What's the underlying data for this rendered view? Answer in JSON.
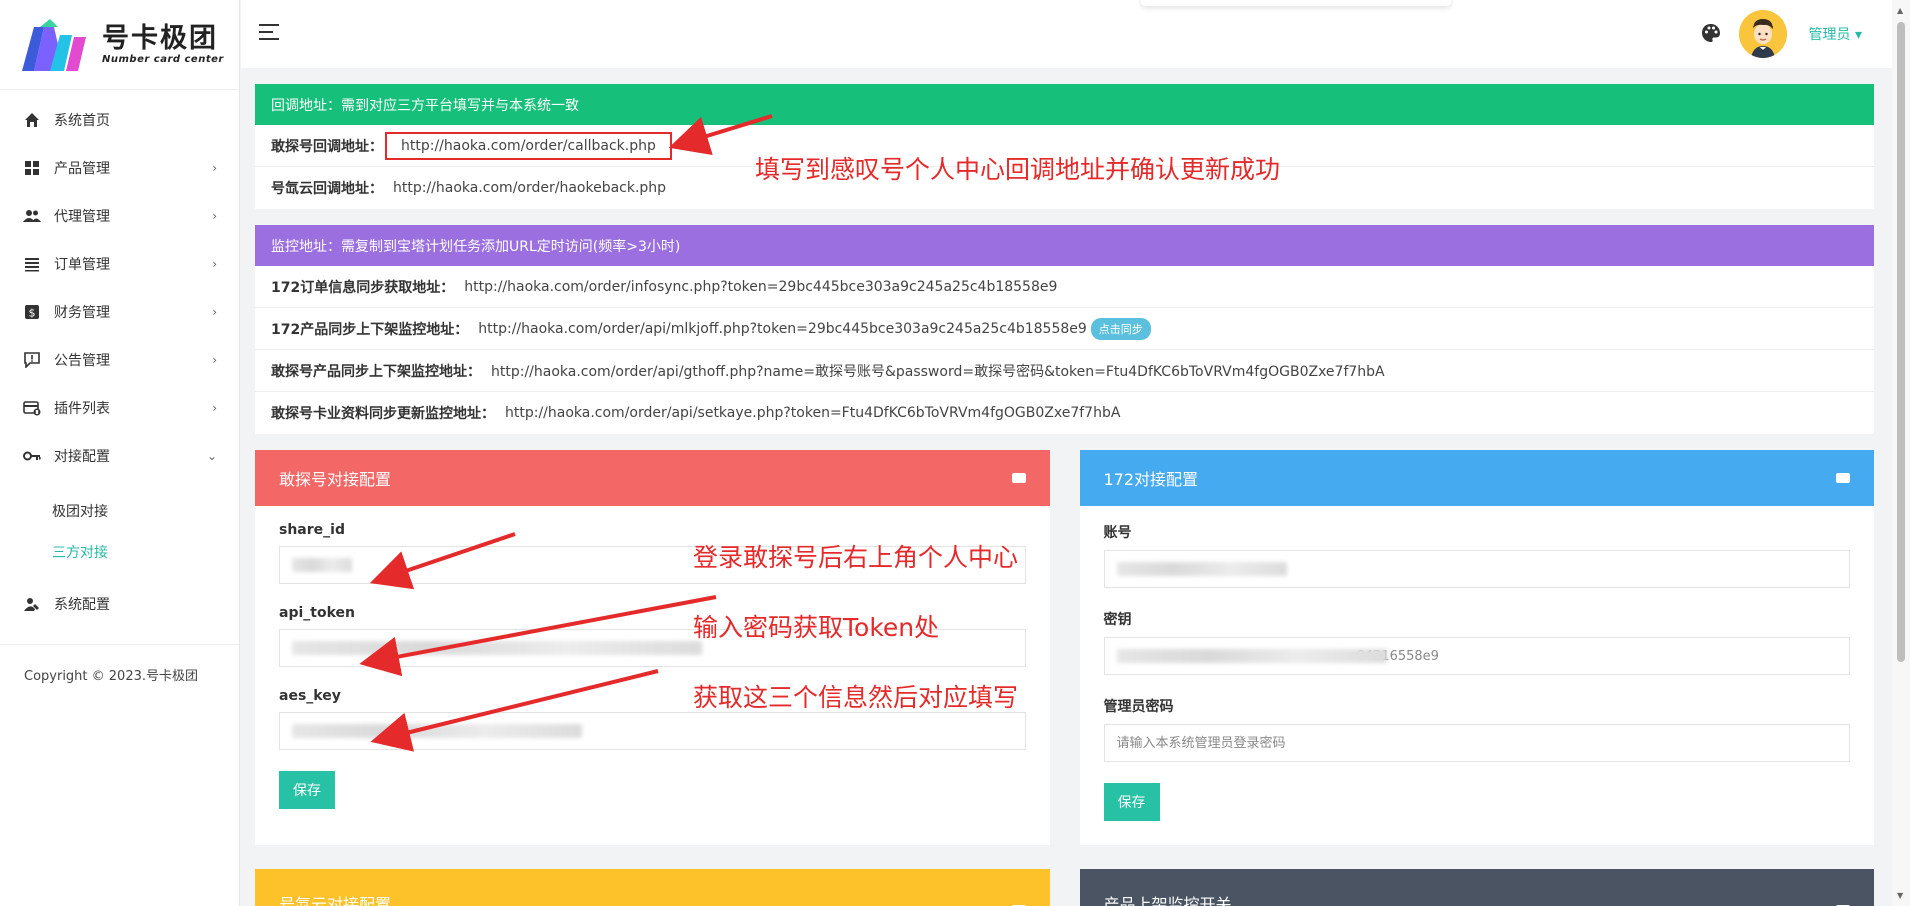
{
  "brand": {
    "title": "号卡极团",
    "subtitle": "Number card center"
  },
  "sidebar": {
    "items": [
      {
        "label": "系统首页",
        "icon": "home-icon",
        "has_arrow": false
      },
      {
        "label": "产品管理",
        "icon": "grid-icon",
        "has_arrow": true
      },
      {
        "label": "代理管理",
        "icon": "users-icon",
        "has_arrow": true
      },
      {
        "label": "订单管理",
        "icon": "list-icon",
        "has_arrow": true
      },
      {
        "label": "财务管理",
        "icon": "dollar-icon",
        "has_arrow": true
      },
      {
        "label": "公告管理",
        "icon": "announcement-icon",
        "has_arrow": true
      },
      {
        "label": "插件列表",
        "icon": "plugin-icon",
        "has_arrow": true
      },
      {
        "label": "对接配置",
        "icon": "key-icon",
        "has_arrow": true,
        "expanded": true
      }
    ],
    "subitems": [
      {
        "label": "极团对接",
        "active": false
      },
      {
        "label": "三方对接",
        "active": true
      }
    ],
    "system_config": "系统配置",
    "arrow_right": "›",
    "arrow_down": "⌄",
    "copyright": "Copyright © 2023.号卡极团"
  },
  "header": {
    "admin_label": "管理员 ▾"
  },
  "callback": {
    "title": "回调地址：需到对应三方平台填写并与本系统一致",
    "rows": [
      {
        "label": "敢探号回调地址：",
        "value": "http://haoka.com/order/callback.php"
      },
      {
        "label": "号氙云回调地址：",
        "value": "http://haoka.com/order/haokeback.php"
      }
    ]
  },
  "monitor": {
    "title": "监控地址：需复制到宝塔计划任务添加URL定时访问(频率>3小时)",
    "rows": [
      {
        "label": "172订单信息同步获取地址：",
        "value": "http://haoka.com/order/infosync.php?token=29bc445bce303a9c245a25c4b18558e9"
      },
      {
        "label": "172产品同步上下架监控地址：",
        "value": "http://haoka.com/order/api/mlkjoff.php?token=29bc445bce303a9c245a25c4b18558e9",
        "button": "点击同步"
      },
      {
        "label": "敢探号产品同步上下架监控地址：",
        "value": "http://haoka.com/order/api/gthoff.php?name=敢探号账号&password=敢探号密码&token=Ftu4DfKC6bToVRVm4fgOGB0Zxe7f7hbA"
      },
      {
        "label": "敢探号卡业资料同步更新监控地址：",
        "value": "http://haoka.com/order/api/setkaye.php?token=Ftu4DfKC6bToVRVm4fgOGB0Zxe7f7hbA"
      }
    ]
  },
  "gantan_panel": {
    "title": "敢探号对接配置",
    "fields": [
      {
        "label": "share_id"
      },
      {
        "label": "api_token"
      },
      {
        "label": "aes_key"
      }
    ],
    "save": "保存"
  },
  "p172_panel": {
    "title": "172对接配置",
    "fields": [
      {
        "label": "账号"
      },
      {
        "label": "密钥",
        "partial": "04216558e9"
      },
      {
        "label": "管理员密码",
        "placeholder": "请输入本系统管理员登录密码"
      }
    ],
    "save": "保存"
  },
  "bottom_panels": [
    {
      "title": "号氙云对接配置",
      "color": "#fdc22a"
    },
    {
      "title": "产品上架监控开关",
      "color": "#4a5463"
    }
  ],
  "annotations": [
    "填写到感叹号个人中心回调地址并确认更新成功",
    "登录敢探号后右上角个人中心",
    "输入密码获取Token处",
    "获取这三个信息然后对应填写"
  ],
  "colors": {
    "accent": "#27b9a8",
    "green_header": "#16c07a",
    "purple_header": "#9b6fdf",
    "red_header": "#f46767",
    "blue_header": "#46aaf0",
    "annotation": "#e42a2a"
  }
}
